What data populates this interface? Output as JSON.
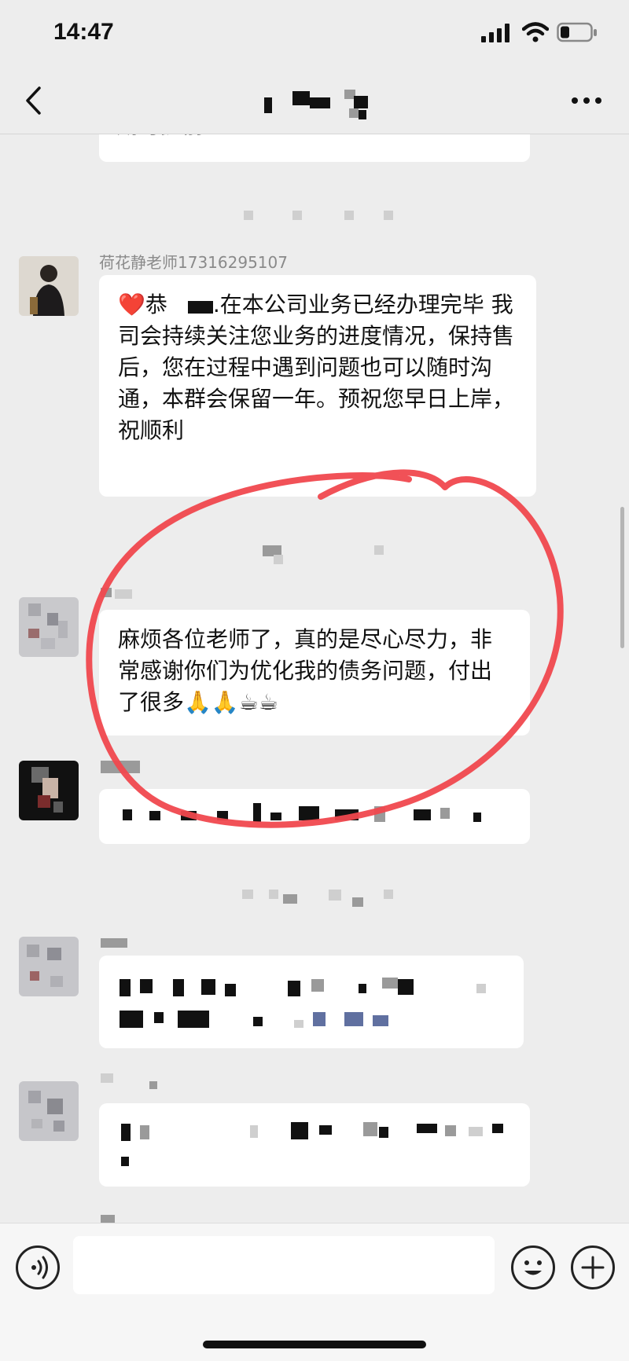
{
  "status_bar": {
    "time": "14:47",
    "icons": [
      "signal-icon",
      "wifi-icon",
      "battery-icon"
    ]
  },
  "nav": {
    "back_icon": "chevron-left-icon",
    "title": "",
    "more_icon": "more-dots-icon"
  },
  "messages": [
    {
      "sender": "",
      "text": "期可提前",
      "partial": true
    },
    {
      "sender": "荷花静老师17316295107",
      "emoji_prefix": "❤️",
      "text_a": "恭",
      "text_b": ".在本公司业务已经办理完毕 我司会持续关注您业务的进度情况，保持售后，您在过程中遇到问题也可以随时沟通，本群会保留一年。预祝您早日上岸，祝顺利"
    },
    {
      "sender": "",
      "text": "麻烦各位老师了，真的是尽心尽力，非常感谢你们为优化我的债务问题，付出了很多",
      "emoji_suffix": "🙏🙏☕☕"
    },
    {
      "sender": "",
      "text": ""
    },
    {
      "sender": "",
      "text": ""
    },
    {
      "sender": "",
      "text": ""
    }
  ],
  "annotation": {
    "color": "#f0484e",
    "shape": "hand-drawn-circle"
  },
  "input_bar": {
    "voice_icon": "voice-icon",
    "emoji_icon": "emoji-icon",
    "plus_icon": "plus-icon"
  }
}
